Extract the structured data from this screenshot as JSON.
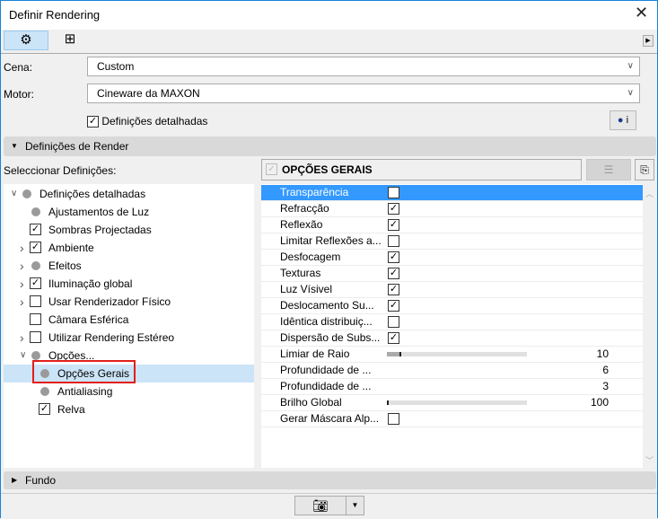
{
  "window": {
    "title": "Definir Rendering"
  },
  "toolbar": {
    "settings_icon": "gear-icon",
    "size_icon": "crop-frame-icon",
    "expand_icon": "triangle-right-icon"
  },
  "fields": {
    "scene": {
      "label": "Cena:",
      "value": "Custom"
    },
    "engine": {
      "label": "Motor:",
      "value": "Cineware da MAXON"
    },
    "detailed": {
      "label": "Definições detalhadas",
      "checked": true
    },
    "info_label": "i"
  },
  "render_section": {
    "title": "Definições de Render",
    "select_label": "Seleccionar Definições:"
  },
  "tree": [
    {
      "label": "Definições detalhadas",
      "level": 0,
      "arrow": "down",
      "marker": "dot"
    },
    {
      "label": "Ajustamentos de Luz",
      "level": 1,
      "arrow": "",
      "marker": "dot"
    },
    {
      "label": "Sombras Projectadas",
      "level": 1,
      "arrow": "",
      "marker": "checked"
    },
    {
      "label": "Ambiente",
      "level": 1,
      "arrow": "right",
      "marker": "checked"
    },
    {
      "label": "Efeitos",
      "level": 1,
      "arrow": "right",
      "marker": "dot"
    },
    {
      "label": "Iluminação global",
      "level": 1,
      "arrow": "right",
      "marker": "checked"
    },
    {
      "label": "Usar Renderizador Físico",
      "level": 1,
      "arrow": "right",
      "marker": "unchecked"
    },
    {
      "label": "Câmara Esférica",
      "level": 1,
      "arrow": "",
      "marker": "unchecked"
    },
    {
      "label": "Utilizar Rendering Estéreo",
      "level": 1,
      "arrow": "right",
      "marker": "unchecked"
    },
    {
      "label": "Opções...",
      "level": 1,
      "arrow": "down",
      "marker": "dot"
    },
    {
      "label": "Opções Gerais",
      "level": 2,
      "arrow": "",
      "marker": "dot",
      "selected": true
    },
    {
      "label": "Antialiasing",
      "level": 2,
      "arrow": "",
      "marker": "dot"
    },
    {
      "label": "Relva",
      "level": 2,
      "arrow": "",
      "marker": "checked"
    }
  ],
  "panel": {
    "title": "OPÇÕES GERAIS",
    "rows": [
      {
        "label": "Transparência",
        "type": "check",
        "checked": true,
        "selected": true
      },
      {
        "label": "Refracção",
        "type": "check",
        "checked": true
      },
      {
        "label": "Reflexão",
        "type": "check",
        "checked": true
      },
      {
        "label": "Limitar Reflexões a...",
        "type": "check",
        "checked": false
      },
      {
        "label": "Desfocagem",
        "type": "check",
        "checked": true
      },
      {
        "label": "Texturas",
        "type": "check",
        "checked": true
      },
      {
        "label": "Luz Vísivel",
        "type": "check",
        "checked": true
      },
      {
        "label": "Deslocamento Su...",
        "type": "check",
        "checked": true
      },
      {
        "label": "Idêntica distribuiç...",
        "type": "check",
        "checked": false
      },
      {
        "label": "Dispersão de Subs...",
        "type": "check",
        "checked": true
      },
      {
        "label": "Limiar de Raio",
        "type": "slider",
        "value": "10",
        "fraction": 0.1
      },
      {
        "label": "Profundidade de ...",
        "type": "value",
        "value": "6"
      },
      {
        "label": "Profundidade de ...",
        "type": "value",
        "value": "3"
      },
      {
        "label": "Brilho Global",
        "type": "slider",
        "value": "100",
        "fraction": 0.0
      },
      {
        "label": "Gerar Máscara Alp...",
        "type": "check",
        "checked": false
      }
    ]
  },
  "background_section": {
    "title": "Fundo"
  },
  "footer": {
    "render_icon": "camera-icon",
    "dropdown_icon": "triangle-down-icon"
  }
}
